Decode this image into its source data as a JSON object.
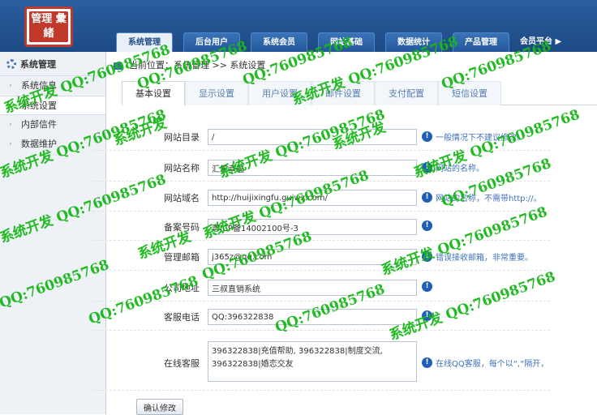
{
  "header": {
    "logo_text": "管理 彙緒",
    "nav": [
      "系统管理",
      "后台用户",
      "系统会员",
      "网站基础",
      "数据统计",
      "产品管理"
    ],
    "nav_more": "会员平台 ▶"
  },
  "sidebar": {
    "title": "系统管理",
    "items": [
      {
        "label": "系统信息",
        "active": false
      },
      {
        "label": "系统设置",
        "active": true
      },
      {
        "label": "内部信件",
        "active": false
      },
      {
        "label": "数据维护",
        "active": false
      }
    ]
  },
  "breadcrumb": "当前位置：系统管理 >> 系统设置",
  "tabs": [
    "基本设置",
    "显示设置",
    "用户设置",
    "邮件设置",
    "支付配置",
    "短信设置"
  ],
  "form": {
    "rows": [
      {
        "label": "网站目录",
        "value": "/",
        "hint": "一般情况下不建议修改。"
      },
      {
        "label": "网站名称",
        "value": "汇集幸福",
        "hint": "网站的名称。"
      },
      {
        "label": "网站域名",
        "value": "http://huijixingfu.guiwz.com/",
        "hint": "网站的名称，不需带http://。"
      },
      {
        "label": "备案号码",
        "value": "粤ICP备14002100号-3",
        "hint": ""
      },
      {
        "label": "管理邮箱",
        "value": "j365z@qq.com",
        "hint": "错误接收邮箱，非常重要。"
      },
      {
        "label": "公司地址",
        "value": "三叔直销系统",
        "hint": ""
      },
      {
        "label": "客服电话",
        "value": "QQ:396322838",
        "hint": ""
      },
      {
        "label": "在线客服",
        "value": "396322838|充值帮助, 396322838|制度交流, 396322838|婚恋交友",
        "hint": "在线QQ客服，每个以“,”隔开，"
      }
    ],
    "submit_label": "确认修改"
  },
  "watermark": {
    "text_a": "系统开发",
    "text_b": "QQ:760985768",
    "text_c": "系统开发 QQ:760985768",
    "color": "#18b818"
  }
}
